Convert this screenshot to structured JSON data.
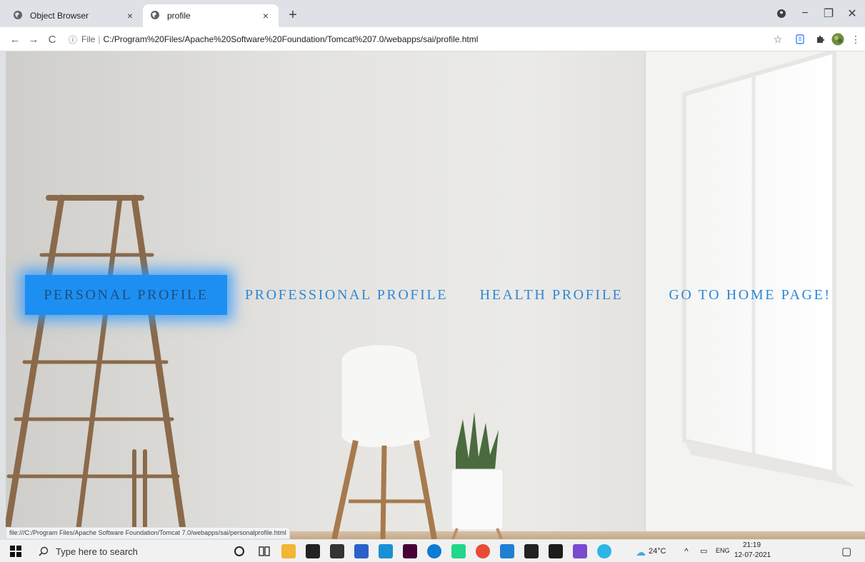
{
  "browser": {
    "tabs": [
      {
        "title": "Object Browser",
        "active": false
      },
      {
        "title": "profile",
        "active": true
      }
    ],
    "close_glyph": "×",
    "new_tab_glyph": "+",
    "window_controls": {
      "minimize": "−",
      "maximize": "❐",
      "close": "✕"
    },
    "nav": {
      "back": "←",
      "forward": "→",
      "reload": "C"
    },
    "address": {
      "info_glyph": "ⓘ",
      "scheme": "File",
      "separator": "|",
      "url": "C:/Program%20Files/Apache%20Software%20Foundation/Tomcat%207.0/webapps/sai/profile.html"
    },
    "status_url": "file:///C:/Program Files/Apache Software Foundation/Tomcat 7.0/webapps/sai/personalprofile.html"
  },
  "menu": {
    "items": [
      {
        "label": "PERSONAL PROFILE",
        "active": true
      },
      {
        "label": "PROFESSIONAL PROFILE",
        "active": false
      },
      {
        "label": "HEALTH PROFILE",
        "active": false
      },
      {
        "label": "GO TO HOME PAGE!",
        "active": false
      }
    ]
  },
  "taskbar": {
    "search_placeholder": "Type here to search",
    "weather": "24°C",
    "language": "ENG",
    "time": "21:19",
    "date": "12-07-2021"
  },
  "colors": {
    "menu_text": "#2e87d6",
    "menu_active_bg": "#1e8ff2",
    "menu_active_text": "#1d4f7d"
  }
}
